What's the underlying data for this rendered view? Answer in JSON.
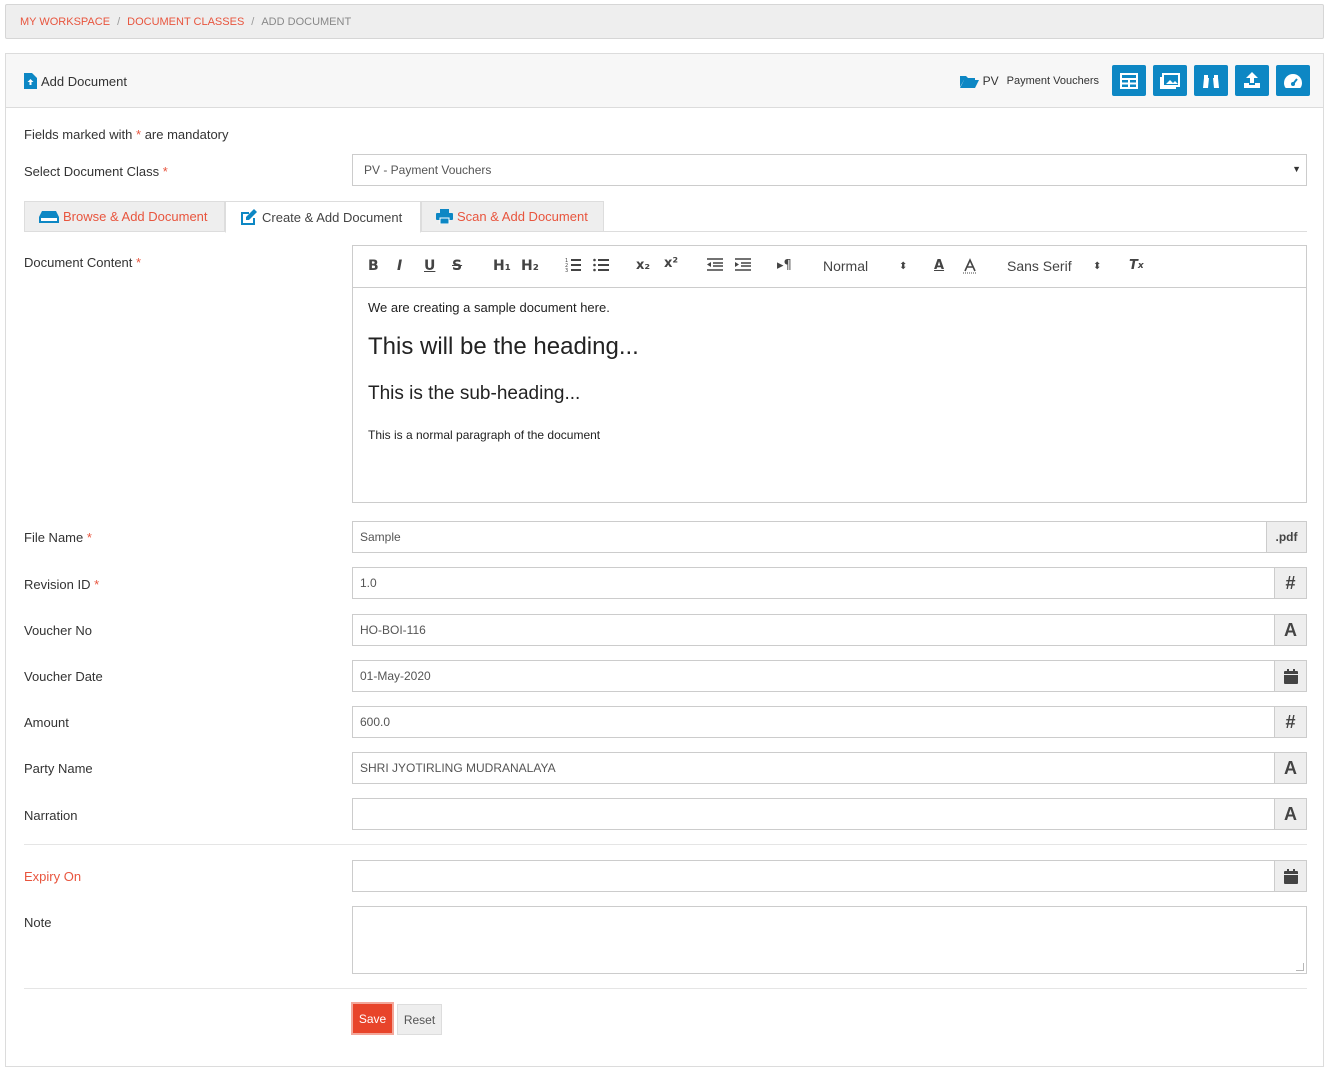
{
  "breadcrumb": [
    "MY WORKSPACE",
    "DOCUMENT CLASSES",
    "ADD DOCUMENT"
  ],
  "header": {
    "title": "Add Document",
    "class_code": "PV",
    "class_name": "Payment Vouchers",
    "icons": [
      "table-icon",
      "images-icon",
      "binoculars-icon",
      "upload-icon",
      "dashboard-icon"
    ]
  },
  "form": {
    "mandatory_note_pre": "Fields marked with",
    "mandatory_star": "*",
    "mandatory_note_post": "are mandatory",
    "class_label": "Select Document Class",
    "class_value": "PV - Payment Vouchers",
    "tabs": [
      "Browse & Add Document",
      "Create & Add Document",
      "Scan & Add Document"
    ],
    "content_label": "Document Content",
    "toolbar": {
      "bold": "B",
      "italic": "I",
      "underline": "U",
      "strike": "S",
      "h1": "H₁",
      "h2": "H₂",
      "sub": "x₂",
      "sup": "x²",
      "para": "▸¶",
      "size": "Normal",
      "font": "Sans Serif",
      "clear": "Tx"
    },
    "editor": {
      "line1": "We are creating a sample document here.",
      "heading": "This will be the heading...",
      "subheading": "This is the sub-heading...",
      "paragraph": "This is a normal paragraph of the document"
    },
    "fields": [
      {
        "label": "File Name",
        "required": true,
        "value": "Sample",
        "addon": ".pdf"
      },
      {
        "label": "Revision ID",
        "required": true,
        "value": "1.0",
        "addon": "#"
      },
      {
        "label": "Voucher No",
        "required": false,
        "value": "HO-BOI-116",
        "addon": "A"
      },
      {
        "label": "Voucher Date",
        "required": false,
        "value": "01-May-2020",
        "addon": "calendar"
      },
      {
        "label": "Amount",
        "required": false,
        "value": "600.0",
        "addon": "#"
      },
      {
        "label": "Party Name",
        "required": false,
        "value": "SHRI JYOTIRLING MUDRANALAYA",
        "addon": "A"
      },
      {
        "label": "Narration",
        "required": false,
        "value": "",
        "addon": "A"
      }
    ],
    "expiry_label": "Expiry On",
    "note_label": "Note",
    "save": "Save",
    "reset": "Reset"
  },
  "colors": {
    "accent": "#0d87c4",
    "danger": "#e8442a",
    "link": "#e8553e"
  }
}
